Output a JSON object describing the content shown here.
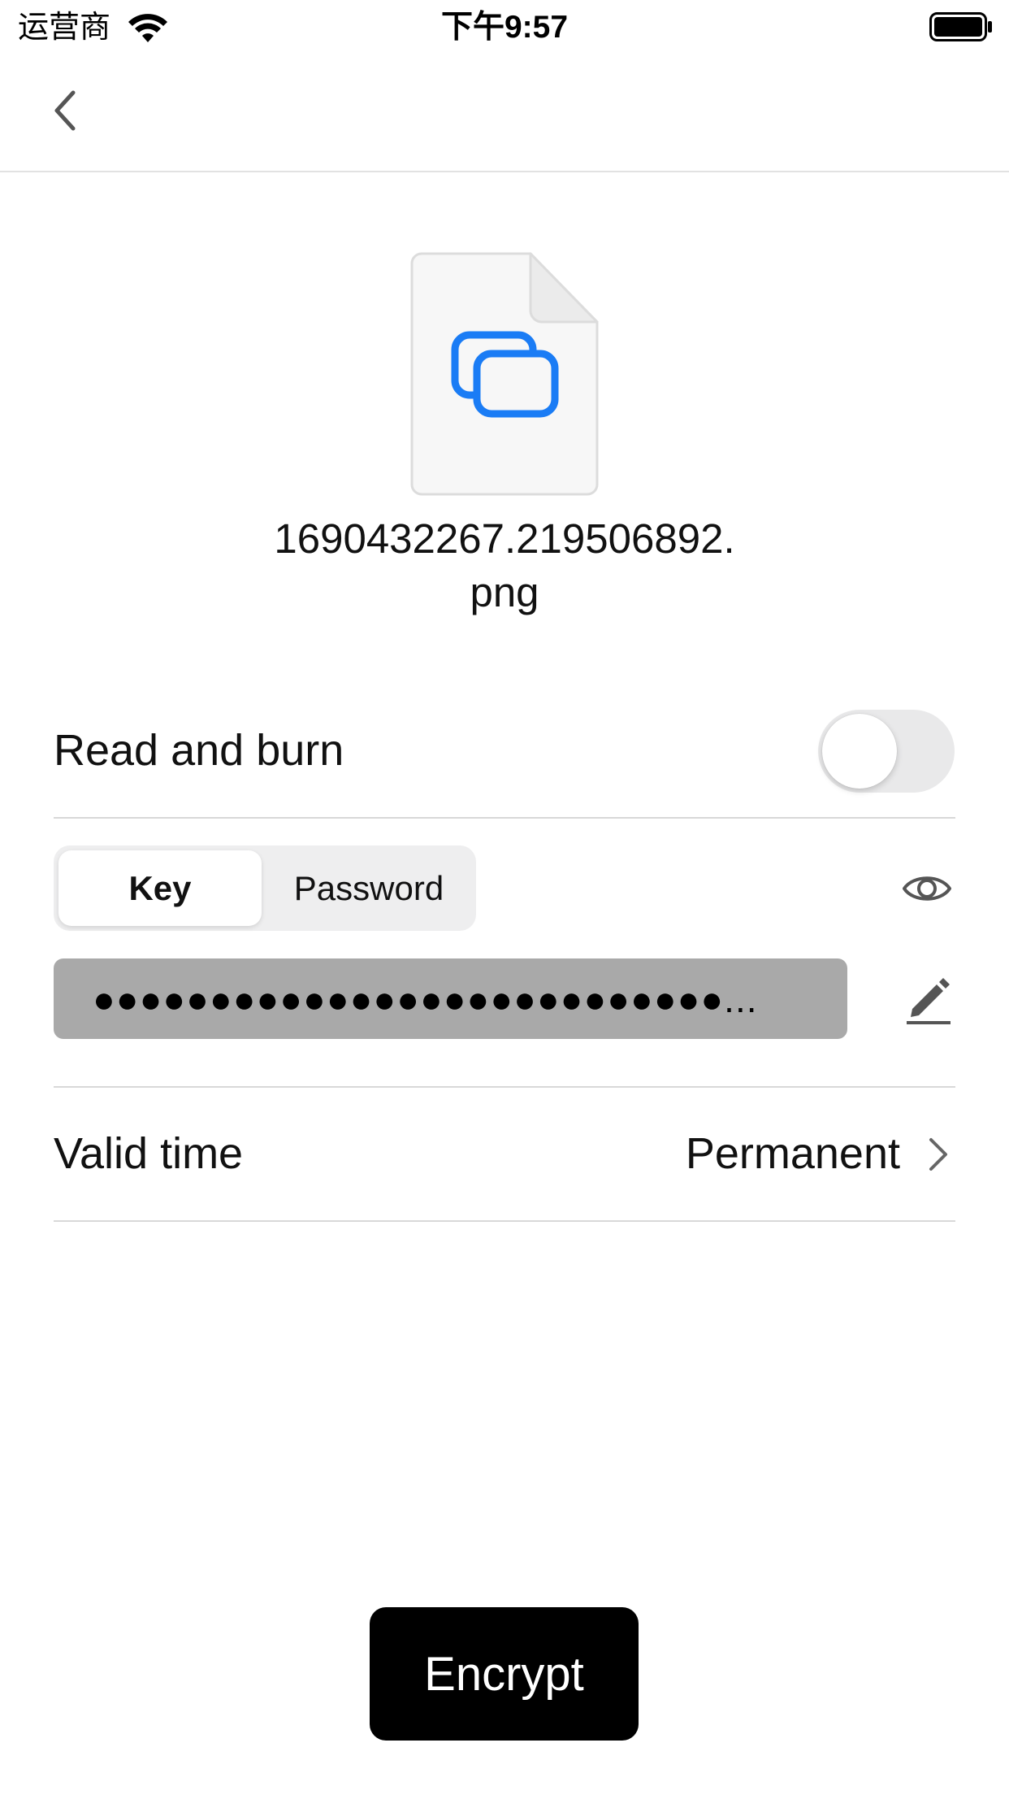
{
  "status_bar": {
    "carrier": "运营商",
    "time": "下午9:57",
    "icons": [
      "wifi-icon",
      "battery-icon"
    ]
  },
  "nav": {
    "back_icon": "chevron-left-icon"
  },
  "file": {
    "icon": "file-image-icon",
    "name_line1": "1690432267.219506892.",
    "name_line2": "png"
  },
  "read_and_burn": {
    "label": "Read and burn",
    "enabled": false
  },
  "auth_mode": {
    "options": [
      "Key",
      "Password"
    ],
    "selected": "Key"
  },
  "key_field": {
    "masked_value": "●●●●●●●●●●●●●●●●●●●●●●●●●●●...",
    "visibility_icon": "eye-icon",
    "edit_icon": "pencil-icon"
  },
  "valid_time": {
    "label": "Valid time",
    "value": "Permanent",
    "chevron_icon": "chevron-right-icon"
  },
  "actions": {
    "encrypt_label": "Encrypt"
  },
  "colors": {
    "accent_blue": "#1a7cf5",
    "toggle_off": "#e9e9ea",
    "key_field_bg": "#a9a9a9",
    "button_bg": "#000000"
  }
}
